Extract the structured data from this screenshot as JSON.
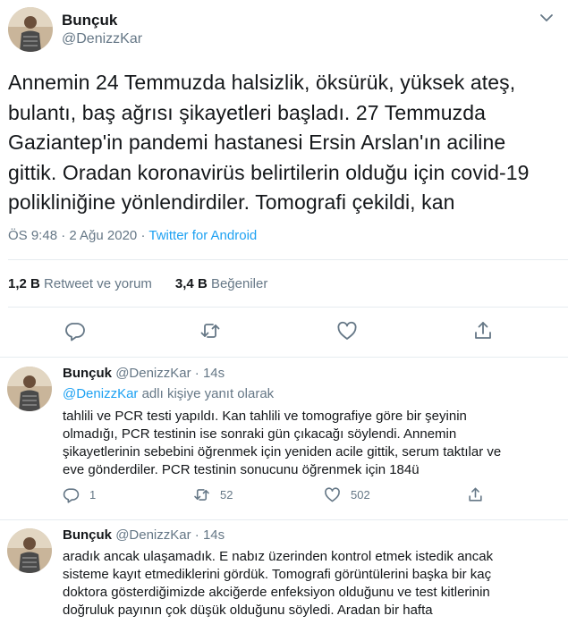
{
  "main_tweet": {
    "display_name": "Bunçuk",
    "handle": "@DenizzKar",
    "text_lines": [
      "Annemin 24 Temmuzda halsizlik, öksürük, yüksek ateş,",
      "bulantı, baş ağrısı şikayetleri başladı. 27 Temmuzda",
      "Gaziantep'in pandemi hastanesi Ersin Arslan'ın aciline",
      "gittik. Oradan koronavirüs belirtilerin olduğu için covid-19",
      "polikliniğine yönlendirdiler. Tomografi çekildi, kan"
    ],
    "timestamp": "ÖS 9:48 · 2 Ağu 2020",
    "separator": "·",
    "source": "Twitter for Android",
    "retweet_count": "1,2 B",
    "retweet_label": "Retweet ve yorum",
    "like_count": "3,4 B",
    "like_label": "Beğeniler",
    "actions": [
      "reply-icon",
      "retweet-icon",
      "like-icon",
      "share-icon"
    ]
  },
  "replies": [
    {
      "display_name": "Bunçuk",
      "handle": "@DenizzKar",
      "time": "· 14s",
      "replying_to_mention": "@DenizzKar",
      "replying_to_suffix": "adlı kişiye yanıt olarak",
      "text_lines": [
        "tahlili ve PCR testi yapıldı. Kan tahlili ve tomografiye göre bir şeyinin",
        "olmadığı, PCR testinin ise sonraki gün çıkacağı söylendi. Annemin",
        "şikayetlerinin sebebini öğrenmek için yeniden acile gittik, serum taktılar ve",
        "eve gönderdiler. PCR testinin sonucunu öğrenmek için 184ü"
      ],
      "reply_count": "1",
      "retweet_count": "52",
      "like_count": "502"
    },
    {
      "display_name": "Bunçuk",
      "handle": "@DenizzKar",
      "time": "· 14s",
      "text_lines": [
        "aradık ancak ulaşamadık. E nabız üzerinden kontrol etmek istedik ancak",
        "sisteme kayıt etmediklerini gördük. Tomografi görüntülerini başka bir kaç",
        "doktora gösterdiğimizde akciğerde enfeksiyon olduğunu ve test kitlerinin",
        "doğruluk payının çok düşük olduğunu söyledi. Aradan bir hafta"
      ]
    }
  ],
  "colors": {
    "accent": "#1da1f2",
    "secondary_text": "#657786",
    "primary_text": "#14171a",
    "divider": "#e6ecf0"
  }
}
